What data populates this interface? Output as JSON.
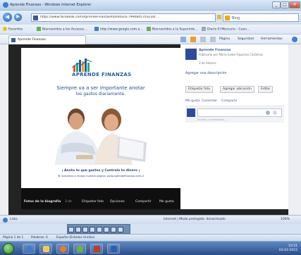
{
  "window": {
    "title": "Aprende Finanzas - Windows Internet Explorer",
    "controls": [
      "_",
      "□",
      "✕"
    ]
  },
  "addressbar": {
    "url": "https://www.facebook.com/AprendeFinanzasP/photos/a.7990845703234/...",
    "search_placeholder": "Bing"
  },
  "favorites_bar": {
    "favorites_label": "Favoritos",
    "items": [
      "Bienvenidos a los Accesos...",
      "http://www.google.com.a...",
      "Bienvenidos a la Superinte...",
      "Diario El Mercurio - Cuen..."
    ]
  },
  "tab": {
    "label": "Aprende Finanzas"
  },
  "command_bar": {
    "items": [
      "Página",
      "Seguridad",
      "Herramientas"
    ]
  },
  "photo": {
    "logo_text": "APRENDE FINANZAS",
    "logo_tagline": "",
    "headline": "Siempre va a ser importante anotar",
    "headline2": "los gastos diariamente.",
    "footer_line1": "¡ Anota tu que gastos y Controla tu dinero ¡",
    "footer_line2": "Te invitamos a revisar nuestra página: www.aprendefinanzas.com.cl"
  },
  "photo_bar": {
    "left_title": "Fotos de la biografía",
    "left_count": "3 de",
    "actions": [
      "Etiquetar foto",
      "Opciones",
      "Compartir",
      "Me gusta"
    ]
  },
  "side": {
    "page_name": "Aprende Finanzas",
    "posted_by": "Publicado por María Isabel Figueroa Cárdenas",
    "likes_count": "3 de febrero",
    "add_desc": "Agregar una descripción",
    "btn_tag": "Etiquetar foto",
    "btn_location": "Agregar ubicación",
    "btn_edit": "Editar",
    "actions": [
      "Me gusta",
      "Comentar",
      "Compartir"
    ],
    "comment_placeholder": "Escribe un comentario..."
  },
  "status": {
    "left": "Listo",
    "zone": "Internet | Modo protegido: desactivado",
    "zoom": "100%"
  },
  "lower_status": {
    "items": [
      "Página 1 de 1",
      "Palabras: 0",
      "Español (Estados Unidos)"
    ]
  },
  "taskbar": {
    "time": "10:51",
    "date": "03-03-2015"
  },
  "colors": {
    "facebook_blue": "#3b5998",
    "ie_titlebar": "#b9d0ea",
    "photo_overlay": "#232323",
    "logo_blue": "#1f5aa8"
  }
}
